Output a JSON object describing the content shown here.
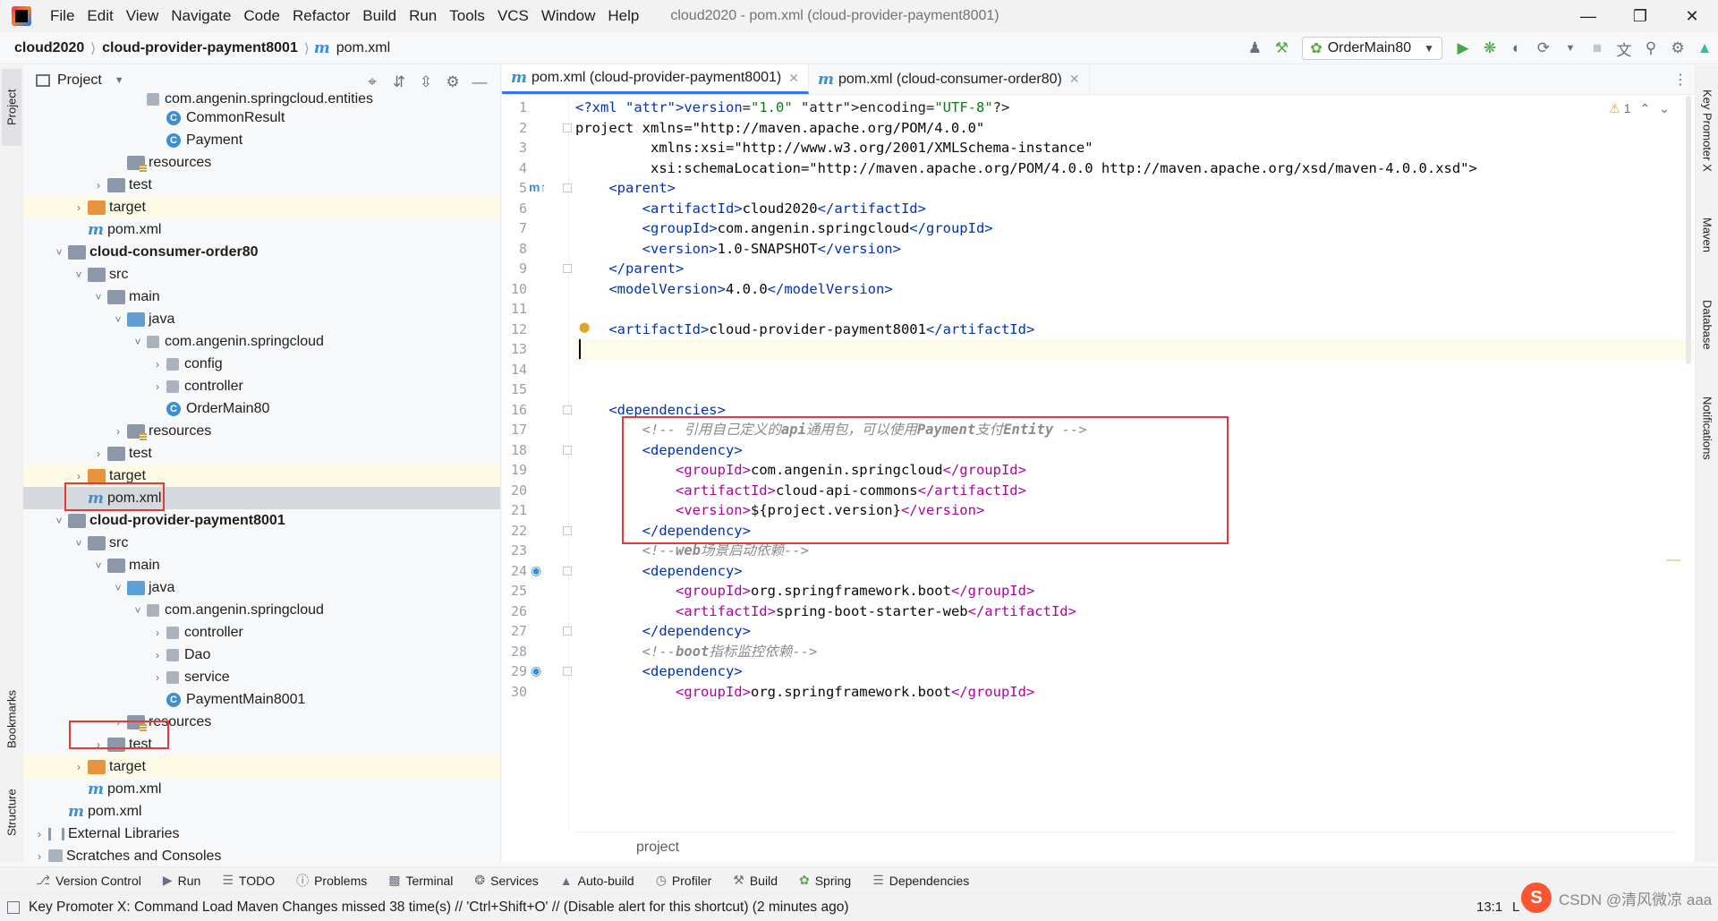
{
  "menubar": {
    "items": [
      "File",
      "Edit",
      "View",
      "Navigate",
      "Code",
      "Refactor",
      "Build",
      "Run",
      "Tools",
      "VCS",
      "Window",
      "Help"
    ],
    "window_title": "cloud2020 - pom.xml (cloud-provider-payment8001)"
  },
  "navbar": {
    "crumbs": [
      "cloud2020",
      "cloud-provider-payment8001",
      "pom.xml"
    ],
    "run_config": "OrderMain80"
  },
  "left_stripe": {
    "project": "Project",
    "bookmarks": "Bookmarks",
    "structure": "Structure"
  },
  "right_stripe": {
    "key_promoter": "Key Promoter X",
    "maven": "Maven",
    "database": "Database",
    "notifications": "Notifications"
  },
  "project": {
    "title": "Project",
    "rows": [
      {
        "label": "com.angenin.springcloud.entities"
      },
      {
        "label": "CommonResult"
      },
      {
        "label": "Payment"
      },
      {
        "label": "resources"
      },
      {
        "label": "test"
      },
      {
        "label": "target"
      },
      {
        "label": "pom.xml"
      },
      {
        "label": "cloud-consumer-order80"
      },
      {
        "label": "src"
      },
      {
        "label": "main"
      },
      {
        "label": "java"
      },
      {
        "label": "com.angenin.springcloud"
      },
      {
        "label": "config"
      },
      {
        "label": "controller"
      },
      {
        "label": "OrderMain80"
      },
      {
        "label": "resources"
      },
      {
        "label": "test"
      },
      {
        "label": "target"
      },
      {
        "label": "pom.xml"
      },
      {
        "label": "cloud-provider-payment8001"
      },
      {
        "label": "src"
      },
      {
        "label": "main"
      },
      {
        "label": "java"
      },
      {
        "label": "com.angenin.springcloud"
      },
      {
        "label": "controller"
      },
      {
        "label": "Dao"
      },
      {
        "label": "service"
      },
      {
        "label": "PaymentMain8001"
      },
      {
        "label": "resources"
      },
      {
        "label": "test"
      },
      {
        "label": "target"
      },
      {
        "label": "pom.xml"
      },
      {
        "label": "pom.xml"
      },
      {
        "label": "External Libraries"
      },
      {
        "label": "Scratches and Consoles"
      }
    ]
  },
  "editor": {
    "tabs": [
      {
        "label": "pom.xml (cloud-provider-payment8001)"
      },
      {
        "label": "pom.xml (cloud-consumer-order80)"
      }
    ],
    "inspection_count": "1",
    "line_numbers": [
      "1",
      "2",
      "3",
      "4",
      "5",
      "6",
      "7",
      "8",
      "9",
      "10",
      "11",
      "12",
      "13",
      "14",
      "15",
      "16",
      "17",
      "18",
      "19",
      "20",
      "21",
      "22",
      "23",
      "24",
      "25",
      "26",
      "27",
      "28",
      "29",
      "30"
    ],
    "lines": [
      "<?xml version=\"1.0\" encoding=\"UTF-8\"?>",
      "<project xmlns=\"http://maven.apache.org/POM/4.0.0\"",
      "         xmlns:xsi=\"http://www.w3.org/2001/XMLSchema-instance\"",
      "         xsi:schemaLocation=\"http://maven.apache.org/POM/4.0.0 http://maven.apache.org/xsd/maven-4.0.0.xsd\">",
      "    <parent>",
      "        <artifactId>cloud2020</artifactId>",
      "        <groupId>com.angenin.springcloud</groupId>",
      "        <version>1.0-SNAPSHOT</version>",
      "    </parent>",
      "    <modelVersion>4.0.0</modelVersion>",
      "",
      "    <artifactId>cloud-provider-payment8001</artifactId>",
      "",
      "",
      "",
      "    <dependencies>",
      "        <!-- 引用自己定义的api通用包，可以使用Payment支付Entity -->",
      "        <dependency>",
      "            <groupId>com.angenin.springcloud</groupId>",
      "            <artifactId>cloud-api-commons</artifactId>",
      "            <version>${project.version}</version>",
      "        </dependency>",
      "        <!--web场景启动依赖-->",
      "        <dependency>",
      "            <groupId>org.springframework.boot</groupId>",
      "            <artifactId>spring-boot-starter-web</artifactId>",
      "        </dependency>",
      "        <!--boot指标监控依赖-->",
      "        <dependency>",
      "            <groupId>org.springframework.boot</groupId>"
    ],
    "footer": "project"
  },
  "bottom_tools": [
    "Version Control",
    "Run",
    "TODO",
    "Problems",
    "Terminal",
    "Services",
    "Auto-build",
    "Profiler",
    "Build",
    "Spring",
    "Dependencies"
  ],
  "status": {
    "message": "Key Promoter X: Command Load Maven Changes missed 38 time(s) // 'Ctrl+Shift+O' // (Disable alert for this shortcut) (2 minutes ago)",
    "position": "13:1",
    "encoding": "L",
    "watermark": "CSDN @清风微凉 aaa"
  },
  "colors": {
    "accent": "#3574f0",
    "annotation_box": "#e53935",
    "current_line": "#fdfce8"
  }
}
